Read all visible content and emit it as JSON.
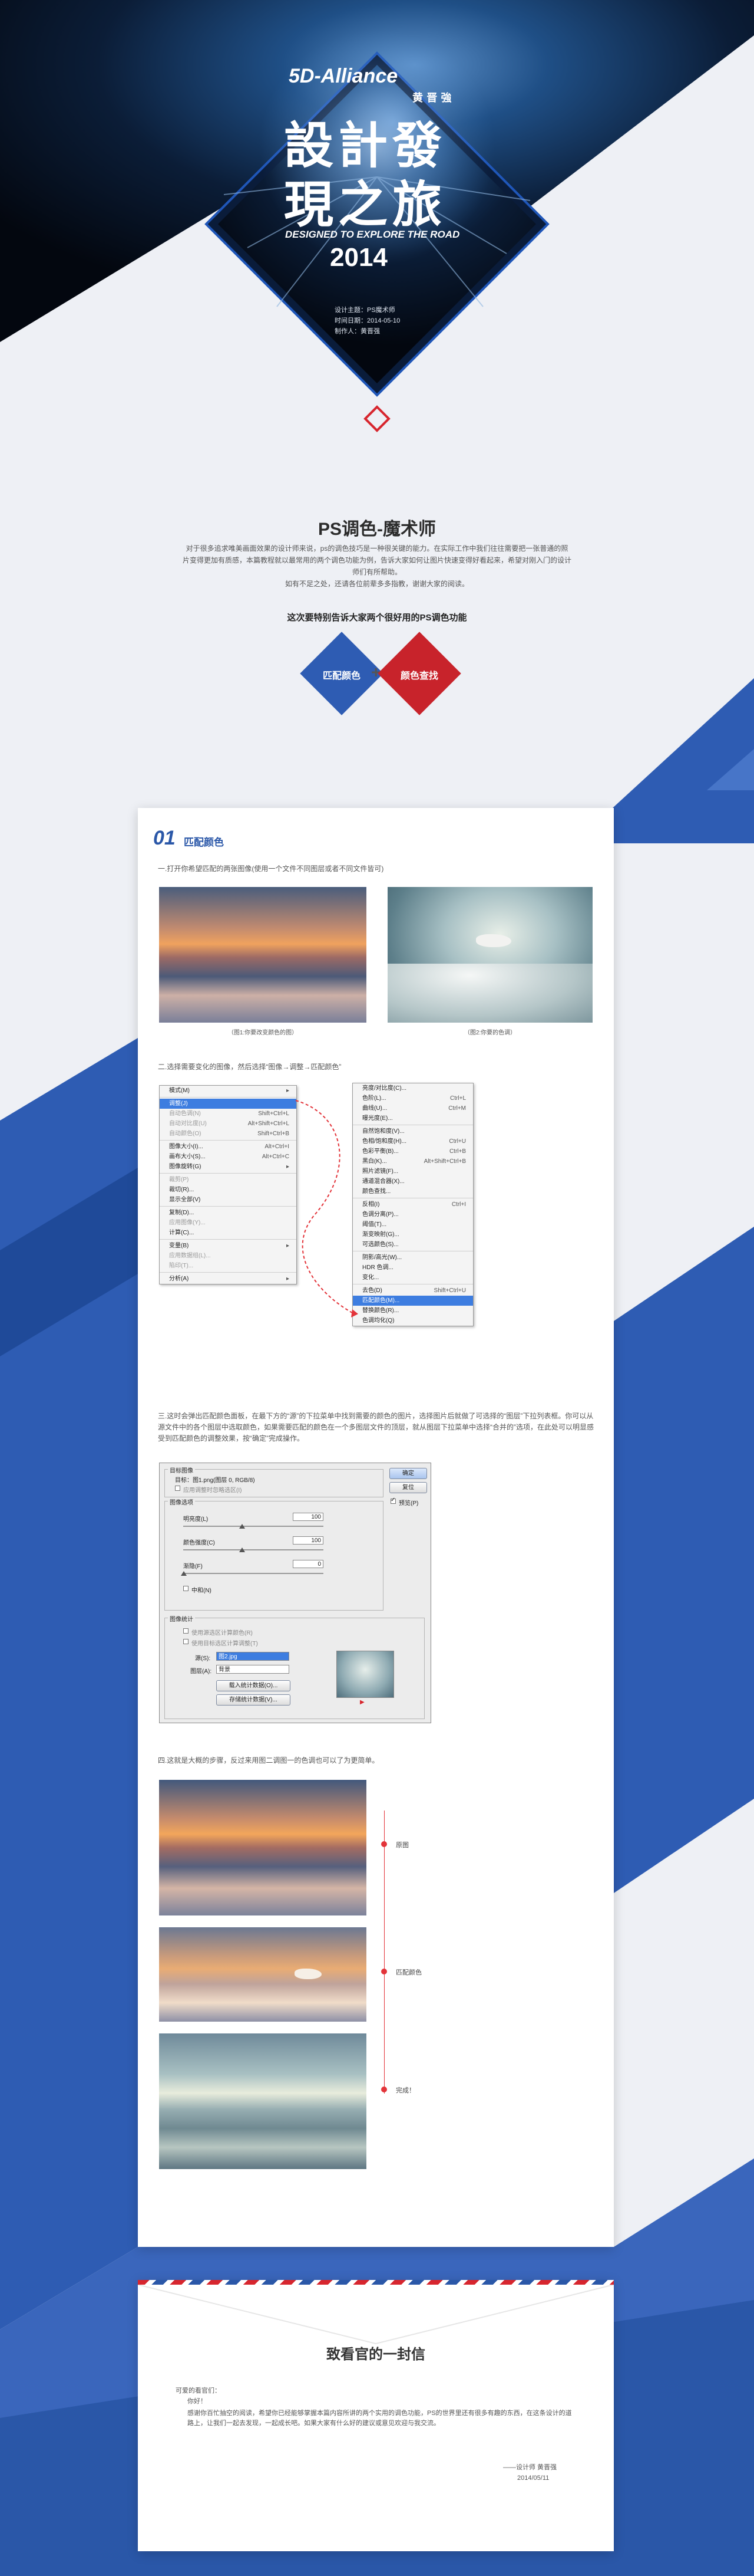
{
  "hero": {
    "brand": "5D-Alliance",
    "brand_sub": "黄 晋 強",
    "title_line1": "設計發",
    "title_line2": "現之旅",
    "subtitle": "DESIGNED TO EXPLORE THE ROAD",
    "year": "2014",
    "meta": [
      "设计主题：PS魔术师",
      "时间日期：2014-05-10",
      "制作人：黄晋强"
    ]
  },
  "intro": {
    "title": "PS调色-魔术师",
    "paragraph": "对于很多追求唯美画面效果的设计师来说，ps的调色技巧是一种很关键的能力。在实际工作中我们往往需要把一张普通的照片变得更加有质感，本篇教程就以最常用的两个调色功能为例，告诉大家如何让图片快速变得好看起来，希望对刚入门的设计师们有所帮助。",
    "paragraph2": "如有不足之处，还请各位前辈多多指教，谢谢大家的阅读。",
    "lead": "这次要特别告诉大家两个很好用的PS调色功能",
    "features": [
      "匹配颜色",
      "颜色查找"
    ],
    "plus": "+"
  },
  "section1": {
    "number": "01",
    "title": "匹配颜色",
    "step1": "一.打开你希望匹配的两张图像(使用一个文件不同图层或者不同文件皆可)",
    "caption_left": "（图1:你要改变颜色的图）",
    "caption_right": "（图2:你要的色调）",
    "step2": "二.选择需要变化的图像，然后选择“图像→调整→匹配颜色”",
    "step3": "三.这时会弹出匹配颜色面板，在最下方的“源”的下拉菜单中找到需要的颜色的图片，选择图片后就做了可选择的“图层”下拉列表框。你可以从源文件中的各个图层中选取颜色，如果需要匹配的颜色在一个多图层文件的顶层，就从图层下拉菜单中选择“合并的”选项，在此处可以明显感受到匹配颜色的调整效果，按“确定”完成操作。",
    "step4": "四.这就是大概的步骤，反过来用图二调图一的色调也可以了为更简单。"
  },
  "menu_left": {
    "items": [
      {
        "label": "模式(M)",
        "shortcut": "▸",
        "state": "normal"
      },
      {
        "label": "调整(J)",
        "shortcut": "",
        "state": "hl"
      },
      {
        "label": "自动色调(N)",
        "shortcut": "Shift+Ctrl+L",
        "state": "dim"
      },
      {
        "label": "自动对比度(U)",
        "shortcut": "Alt+Shift+Ctrl+L",
        "state": "dim"
      },
      {
        "label": "自动颜色(O)",
        "shortcut": "Shift+Ctrl+B",
        "state": "dim"
      },
      {
        "label": "图像大小(I)...",
        "shortcut": "Alt+Ctrl+I",
        "state": "normal"
      },
      {
        "label": "画布大小(S)...",
        "shortcut": "Alt+Ctrl+C",
        "state": "normal"
      },
      {
        "label": "图像旋转(G)",
        "shortcut": "▸",
        "state": "normal"
      },
      {
        "label": "裁剪(P)",
        "shortcut": "",
        "state": "dim"
      },
      {
        "label": "裁切(R)...",
        "shortcut": "",
        "state": "normal"
      },
      {
        "label": "显示全部(V)",
        "shortcut": "",
        "state": "normal"
      },
      {
        "label": "复制(D)...",
        "shortcut": "",
        "state": "normal"
      },
      {
        "label": "应用图像(Y)...",
        "shortcut": "",
        "state": "dim"
      },
      {
        "label": "计算(C)...",
        "shortcut": "",
        "state": "normal"
      },
      {
        "label": "变量(B)",
        "shortcut": "▸",
        "state": "normal"
      },
      {
        "label": "应用数据组(L)...",
        "shortcut": "",
        "state": "dim"
      },
      {
        "label": "陷印(T)...",
        "shortcut": "",
        "state": "dim"
      },
      {
        "label": "分析(A)",
        "shortcut": "▸",
        "state": "normal"
      }
    ]
  },
  "menu_right": {
    "items": [
      {
        "label": "亮度/对比度(C)...",
        "shortcut": "",
        "state": "normal"
      },
      {
        "label": "色阶(L)...",
        "shortcut": "Ctrl+L",
        "state": "normal"
      },
      {
        "label": "曲线(U)...",
        "shortcut": "Ctrl+M",
        "state": "normal"
      },
      {
        "label": "曝光度(E)...",
        "shortcut": "",
        "state": "normal"
      },
      {
        "label": "自然饱和度(V)...",
        "shortcut": "",
        "state": "normal"
      },
      {
        "label": "色相/饱和度(H)...",
        "shortcut": "Ctrl+U",
        "state": "normal"
      },
      {
        "label": "色彩平衡(B)...",
        "shortcut": "Ctrl+B",
        "state": "normal"
      },
      {
        "label": "黑白(K)...",
        "shortcut": "Alt+Shift+Ctrl+B",
        "state": "normal"
      },
      {
        "label": "照片滤镜(F)...",
        "shortcut": "",
        "state": "normal"
      },
      {
        "label": "通道混合器(X)...",
        "shortcut": "",
        "state": "normal"
      },
      {
        "label": "颜色查找...",
        "shortcut": "",
        "state": "normal"
      },
      {
        "label": "反相(I)",
        "shortcut": "Ctrl+I",
        "state": "normal"
      },
      {
        "label": "色调分离(P)...",
        "shortcut": "",
        "state": "normal"
      },
      {
        "label": "阈值(T)...",
        "shortcut": "",
        "state": "normal"
      },
      {
        "label": "渐变映射(G)...",
        "shortcut": "",
        "state": "normal"
      },
      {
        "label": "可选颜色(S)...",
        "shortcut": "",
        "state": "normal"
      },
      {
        "label": "阴影/高光(W)...",
        "shortcut": "",
        "state": "normal"
      },
      {
        "label": "HDR 色调...",
        "shortcut": "",
        "state": "normal"
      },
      {
        "label": "变化...",
        "shortcut": "",
        "state": "normal"
      },
      {
        "label": "去色(D)",
        "shortcut": "Shift+Ctrl+U",
        "state": "normal"
      },
      {
        "label": "匹配颜色(M)...",
        "shortcut": "",
        "state": "hl"
      },
      {
        "label": "替换颜色(R)...",
        "shortcut": "",
        "state": "normal"
      },
      {
        "label": "色调均化(Q)",
        "shortcut": "",
        "state": "normal"
      }
    ]
  },
  "dialog": {
    "target_label": "目标图像",
    "target_value": "目标：图1.png(图层 0, RGB/8)",
    "ignore_selection": "应用调整时忽略选区(I)",
    "image_options": "图像选项",
    "luminance_label": "明亮度(L)",
    "luminance_value": "100",
    "intensity_label": "颜色强度(C)",
    "intensity_value": "100",
    "fade_label": "渐隐(F)",
    "fade_value": "0",
    "neutralize": "中和(N)",
    "ok": "确定",
    "reset": "复位",
    "preview": "预览(P)",
    "stats_label": "图像统计",
    "use_selection_source": "使用源选区计算颜色(R)",
    "use_selection_target": "使用目标选区计算调整(T)",
    "source_label": "源(S):",
    "source_value": "图2.jpg",
    "layer_label": "图层(A):",
    "layer_value": "背景",
    "load_stats": "载入统计数据(O)...",
    "save_stats": "存储统计数据(V)..."
  },
  "timeline": {
    "labels": [
      "原图",
      "匹配颜色",
      "完成！"
    ]
  },
  "letter": {
    "title": "致看官的一封信",
    "greeting": "可爱的看官们：",
    "hello": "你好！",
    "body": "感谢你百忙抽空的阅读，希望你已经能够掌握本篇内容所讲的两个实用的调色功能，PS的世界里还有很多有趣的东西，在这条设计的道路上，让我们一起去发现，一起成长吧。如果大家有什么好的建议或意见欢迎与我交流。",
    "sign": "——设计师 黄晋强",
    "date": "2014/05/11"
  }
}
